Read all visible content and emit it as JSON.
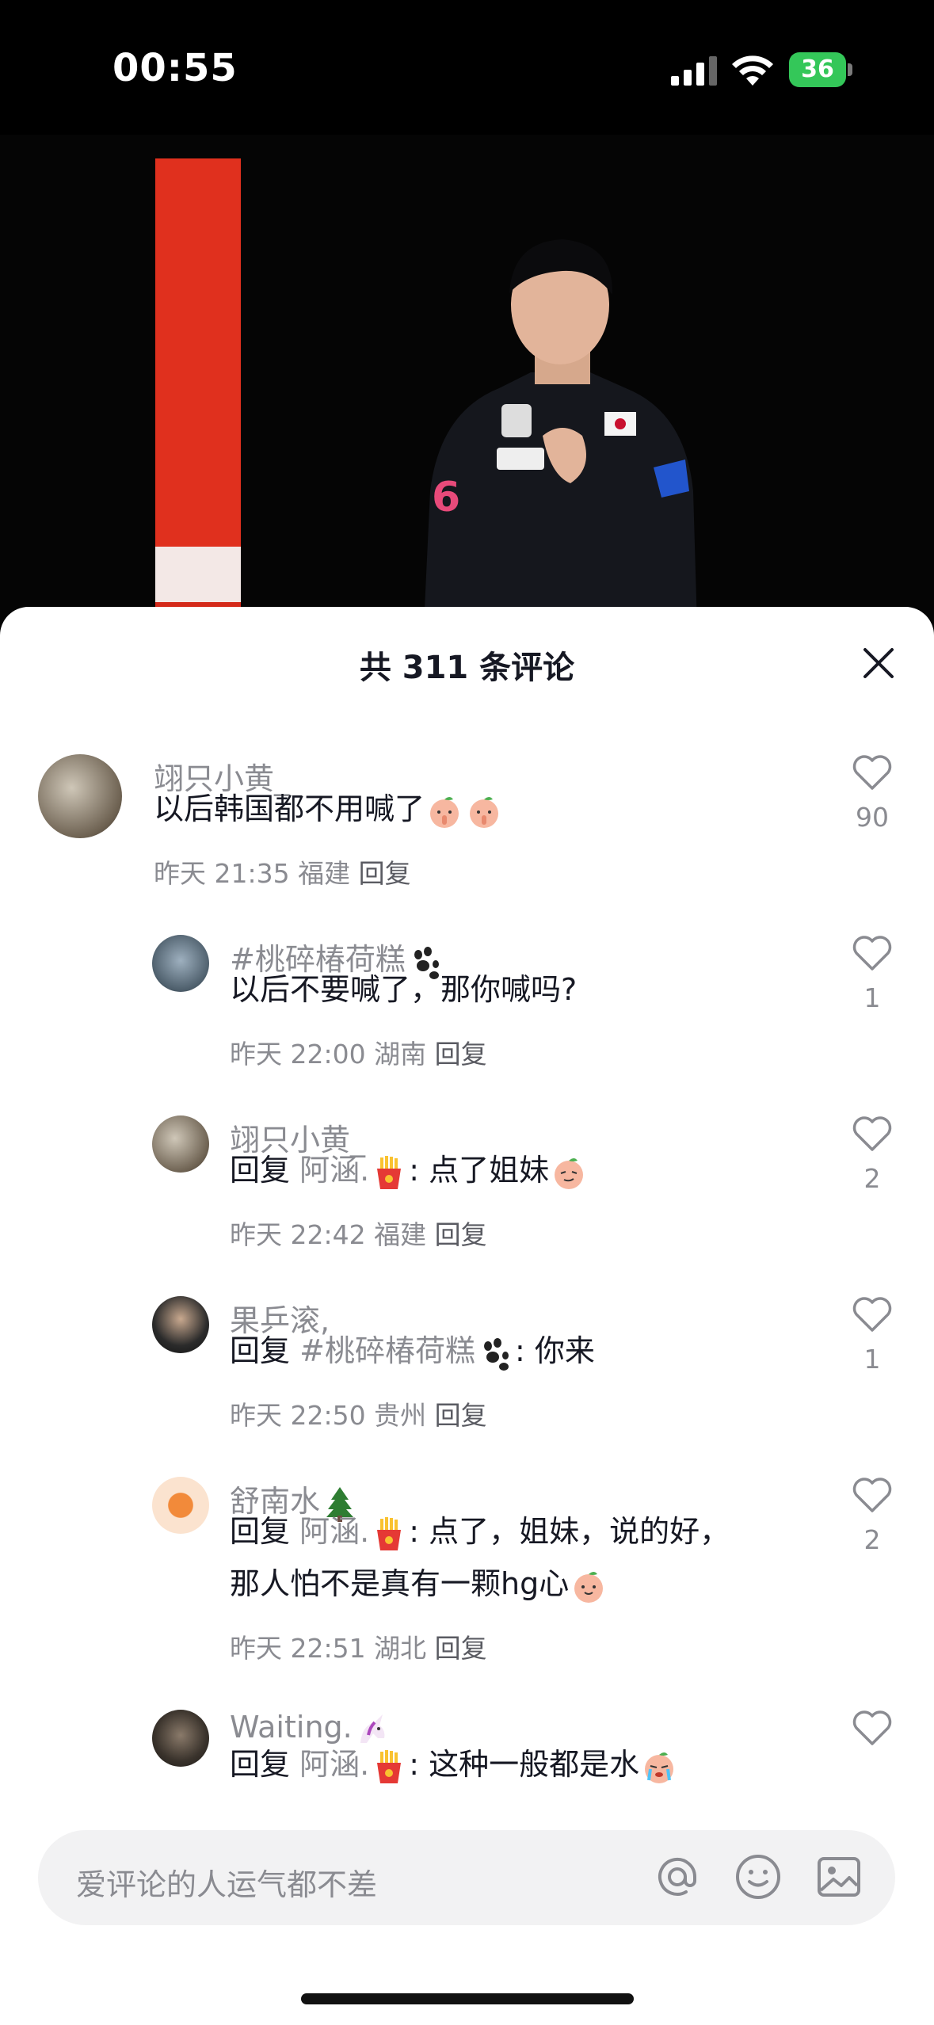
{
  "status_bar": {
    "time": "00:55",
    "battery": "36"
  },
  "sheet": {
    "title": "共 311 条评论",
    "close_icon": "close-icon"
  },
  "comments": [
    {
      "user": "翊只小黄_",
      "text": "以后韩国都不用喊了",
      "emoji": [
        "peach-shush-emoji",
        "peach-shush-emoji"
      ],
      "time": "昨天 21:35",
      "location": "福建",
      "reply_label": "回复",
      "likes": "90"
    },
    {
      "user": "#桃碎椿荷糕",
      "user_emoji": "paw-prints-emoji",
      "text": "以后不要喊了，那你喊吗?",
      "time": "昨天 22:00",
      "location": "湖南",
      "reply_label": "回复",
      "likes": "1"
    },
    {
      "user": "翊只小黄_",
      "reply_prefix": "回复",
      "reply_to": "阿涵.",
      "reply_to_emoji": "fries-emoji",
      "text": ": 点了姐妹",
      "text_emoji": "peach-smug-emoji",
      "time": "昨天 22:42",
      "location": "福建",
      "reply_label": "回复",
      "likes": "2"
    },
    {
      "user": "果乒滚,",
      "reply_prefix": "回复",
      "reply_to": "#桃碎椿荷糕",
      "reply_to_emoji": "paw-prints-emoji",
      "text": ": 你来",
      "time": "昨天 22:50",
      "location": "贵州",
      "reply_label": "回复",
      "likes": "1"
    },
    {
      "user": "舒南水",
      "user_emoji": "tree-emoji",
      "reply_prefix": "回复",
      "reply_to": "阿涵.",
      "reply_to_emoji": "fries-emoji",
      "text": ": 点了，姐妹，说的好，",
      "text_line2": "那人怕不是真有一颗hg心",
      "text_emoji": "peach-smile-emoji",
      "time": "昨天 22:51",
      "location": "湖北",
      "reply_label": "回复",
      "likes": "2"
    },
    {
      "user": "Waiting.",
      "user_emoji": "unicorn-emoji",
      "reply_prefix": "回复",
      "reply_to": "阿涵.",
      "reply_to_emoji": "fries-emoji",
      "text": ": 这种一般都是水",
      "text_emoji": "peach-cry-emoji",
      "likes": ""
    }
  ],
  "input": {
    "placeholder": "爱评论的人运气都不差",
    "icons": [
      "at-icon",
      "emoji-icon",
      "image-icon"
    ]
  },
  "colors": {
    "text": "#161823",
    "secondary": "#8a8b91",
    "battery": "#34c759",
    "banner": "#e0301e"
  }
}
